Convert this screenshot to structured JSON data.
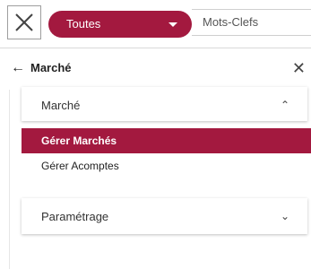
{
  "topbar": {
    "close_icon": "close-x-icon",
    "category_select": {
      "value": "Toutes",
      "color": "#a3193f"
    },
    "keywords_placeholder": "Mots-Clefs"
  },
  "panel": {
    "back_icon": "arrow-left-icon",
    "title": "Marché",
    "close_icon": "close-icon",
    "sections": [
      {
        "label": "Marché",
        "expanded": true,
        "items": [
          {
            "label": "Gérer Marchés",
            "active": true
          },
          {
            "label": "Gérer Acomptes",
            "active": false
          }
        ]
      },
      {
        "label": "Paramétrage",
        "expanded": false
      }
    ]
  },
  "colors": {
    "accent": "#a3193f"
  }
}
